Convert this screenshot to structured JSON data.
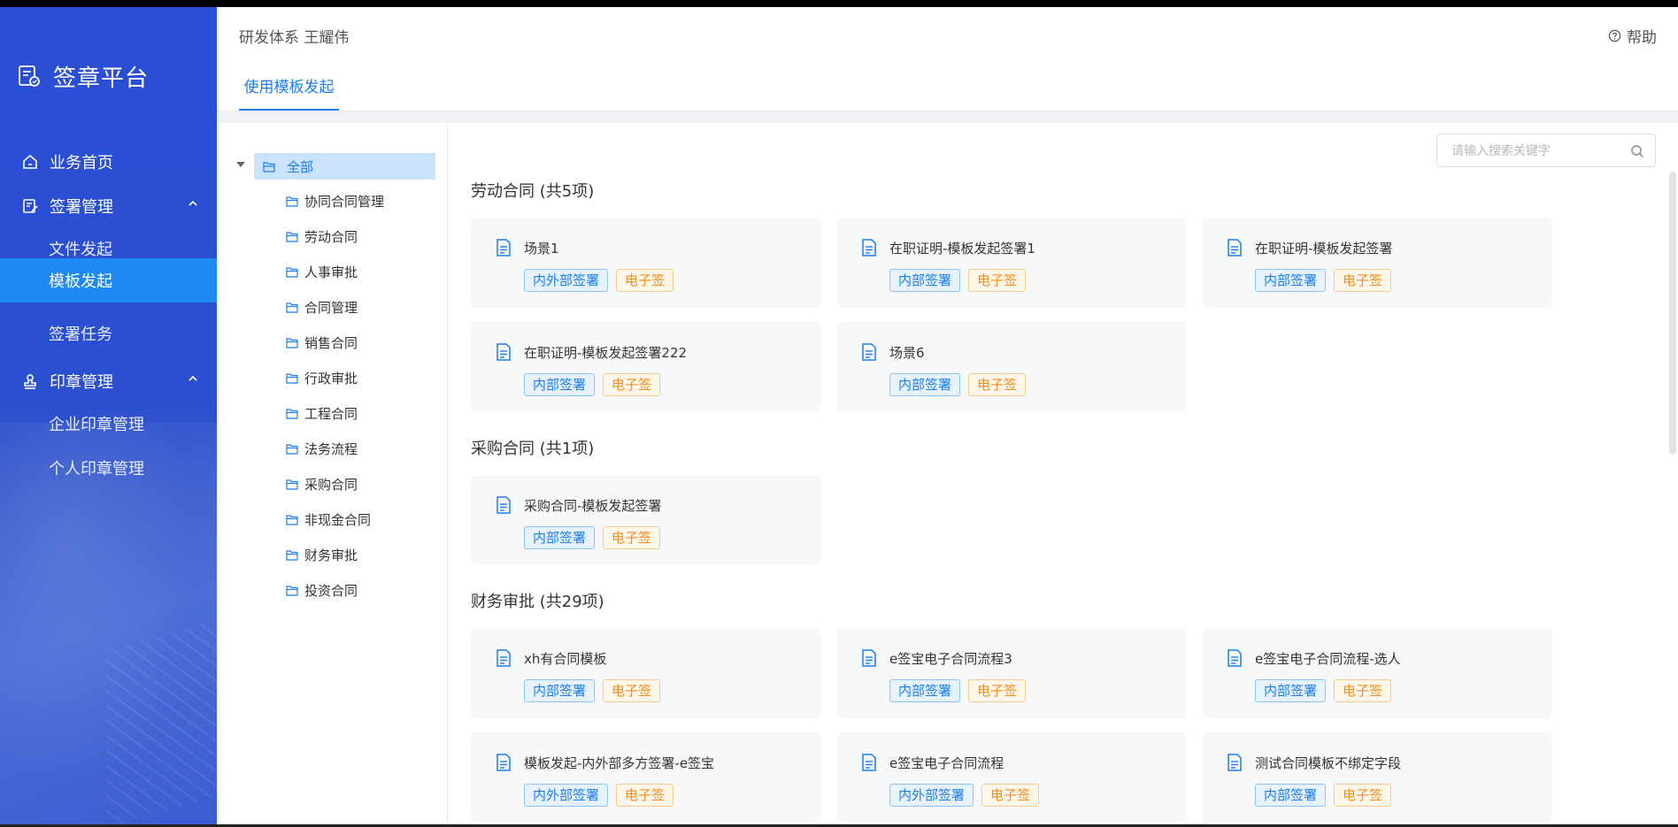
{
  "brand": {
    "title": "签章平台",
    "accent": "#2a4fd6"
  },
  "nav": {
    "home": "业务首页",
    "sign_mgmt": "签署管理",
    "file_launch": "文件发起",
    "template_launch": "模板发起",
    "sign_tasks": "签署任务",
    "seal_mgmt": "印章管理",
    "company_seal": "企业印章管理",
    "personal_seal": "个人印章管理"
  },
  "header": {
    "user": "研发体系 王耀伟",
    "help": "帮助"
  },
  "tabs": {
    "active": "使用模板发起"
  },
  "search": {
    "placeholder": "请输入搜索关键字",
    "value": ""
  },
  "tree": {
    "root": "全部",
    "items": [
      "协同合同管理",
      "劳动合同",
      "人事审批",
      "合同管理",
      "销售合同",
      "行政审批",
      "工程合同",
      "法务流程",
      "采购合同",
      "非现金合同",
      "财务审批",
      "投资合同"
    ]
  },
  "groups": [
    {
      "title": "劳动合同 (共5项)",
      "cards": [
        {
          "title": "场景1",
          "tags": [
            "内外部签署",
            "电子签"
          ]
        },
        {
          "title": "在职证明-模板发起签署1",
          "tags": [
            "内部签署",
            "电子签"
          ]
        },
        {
          "title": "在职证明-模板发起签署",
          "tags": [
            "内部签署",
            "电子签"
          ]
        },
        {
          "title": "在职证明-模板发起签署222",
          "tags": [
            "内部签署",
            "电子签"
          ]
        },
        {
          "title": "场景6",
          "tags": [
            "内部签署",
            "电子签"
          ]
        }
      ]
    },
    {
      "title": "采购合同 (共1项)",
      "cards": [
        {
          "title": "采购合同-模板发起签署",
          "tags": [
            "内部签署",
            "电子签"
          ]
        }
      ]
    },
    {
      "title": "财务审批 (共29项)",
      "cards": [
        {
          "title": "xh有合同模板",
          "tags": [
            "内部签署",
            "电子签"
          ]
        },
        {
          "title": "e签宝电子合同流程3",
          "tags": [
            "内部签署",
            "电子签"
          ]
        },
        {
          "title": "e签宝电子合同流程-选人",
          "tags": [
            "内部签署",
            "电子签"
          ]
        },
        {
          "title": "模板发起-内外部多方签署-e签宝",
          "tags": [
            "内外部签署",
            "电子签"
          ]
        },
        {
          "title": "e签宝电子合同流程",
          "tags": [
            "内外部签署",
            "电子签"
          ]
        },
        {
          "title": "测试合同模板不绑定字段",
          "tags": [
            "内部签署",
            "电子签"
          ]
        }
      ]
    }
  ]
}
